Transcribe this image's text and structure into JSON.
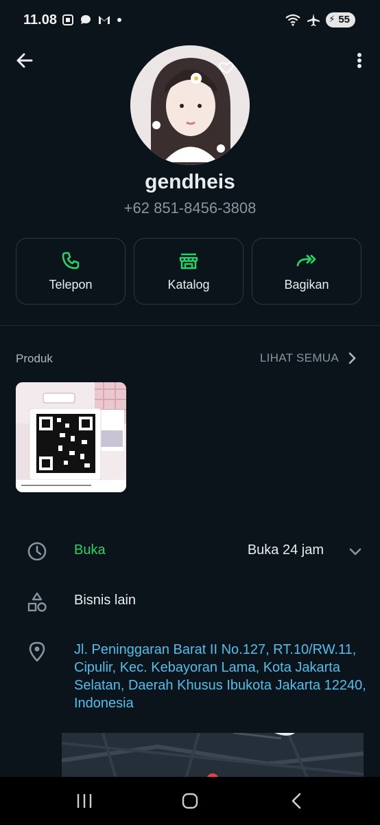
{
  "status_bar": {
    "time": "11.08",
    "battery": "55",
    "icons_left": [
      "screenshot-icon",
      "chat-bubble-icon",
      "gmail-icon",
      "dot-icon"
    ],
    "icons_right": [
      "wifi-icon",
      "airplane-icon",
      "battery-icon"
    ]
  },
  "header": {
    "back_icon": "arrow-left-icon",
    "menu_icon": "more-vertical-icon"
  },
  "profile": {
    "name": "gendheis",
    "phone": "+62 851-8456-3808"
  },
  "actions": [
    {
      "label": "Telepon",
      "icon": "phone-icon"
    },
    {
      "label": "Katalog",
      "icon": "storefront-icon"
    },
    {
      "label": "Bagikan",
      "icon": "share-forward-icon"
    }
  ],
  "produk": {
    "title": "Produk",
    "see_all": "LIHAT SEMUA"
  },
  "hours": {
    "status": "Buka",
    "detail": "Buka 24 jam"
  },
  "category": {
    "label": "Bisnis lain"
  },
  "address": {
    "text": "Jl. Peninggaran Barat II No.127, RT.10/RW.11, Cipulir, Kec. Kebayoran Lama, Kota Jakarta Selatan, Daerah Khusus Ibukota Jakarta 12240, Indonesia"
  },
  "colors": {
    "background": "#0b141a",
    "accent_green": "#25d366",
    "link_blue": "#53bdeb",
    "border": "#2a3942"
  }
}
